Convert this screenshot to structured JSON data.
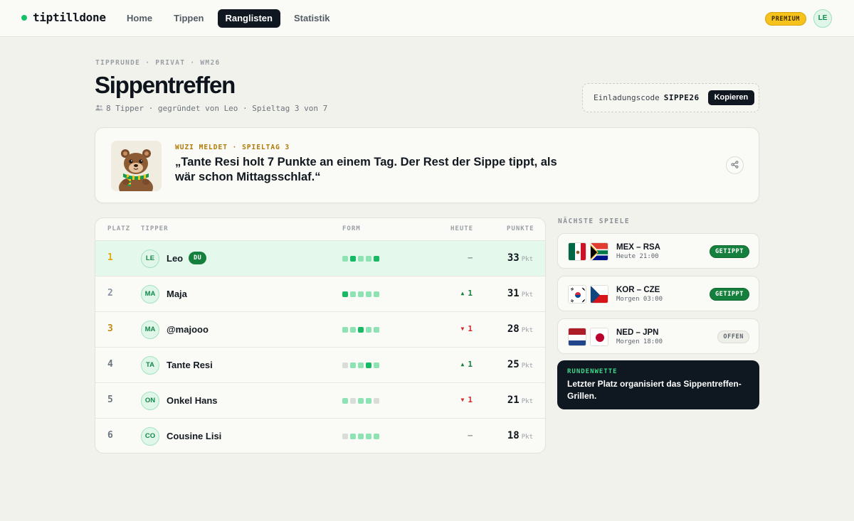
{
  "app": {
    "logo_text": "tiptilldone",
    "nav": [
      {
        "label": "Home",
        "active": false
      },
      {
        "label": "Tippen",
        "active": false
      },
      {
        "label": "Ranglisten",
        "active": true
      },
      {
        "label": "Statistik",
        "active": false
      }
    ],
    "premium_badge": "PREMIUM",
    "user_initials": "LE"
  },
  "header": {
    "eyebrow": "TIPPRUNDE · PRIVAT · WM26",
    "title": "Sippentreffen",
    "meta_icon": "people-icon",
    "meta": "8 Tipper · gegründet von Leo · Spieltag 3 von 7",
    "invite_label": "Einladungscode",
    "invite_code": "SIPPE26",
    "copy_label": "Kopieren"
  },
  "quote": {
    "kicker": "WUZI MELDET · SPIELTAG 3",
    "text": "„Tante Resi holt 7 Punkte an einem Tag. Der Rest der Sippe tippt, als wär schon Mittagsschlaf.“",
    "mascot": "otter-mascot",
    "share_icon": "share-icon"
  },
  "leaderboard": {
    "columns": {
      "rank": "PLATZ",
      "tipper": "TIPPER",
      "form": "FORM",
      "today": "HEUTE",
      "points": "PUNKTE"
    },
    "points_unit": "Pkt",
    "rows": [
      {
        "rank": "1",
        "initials": "LE",
        "name": "Leo",
        "badge": "DU",
        "form": [
          "d",
          "w",
          "d",
          "d",
          "w"
        ],
        "trend": "flat",
        "today": "–",
        "points": "33"
      },
      {
        "rank": "2",
        "initials": "MA",
        "name": "Maja",
        "form": [
          "w",
          "d",
          "d",
          "d",
          "d"
        ],
        "trend": "up",
        "today": "1",
        "points": "31"
      },
      {
        "rank": "3",
        "initials": "MA",
        "name": "@majooo",
        "form": [
          "d",
          "d",
          "w",
          "d",
          "d"
        ],
        "trend": "down",
        "today": "1",
        "points": "28"
      },
      {
        "rank": "4",
        "initials": "TA",
        "name": "Tante Resi",
        "form": [
          "l",
          "d",
          "d",
          "w",
          "d"
        ],
        "trend": "up",
        "today": "1",
        "points": "25"
      },
      {
        "rank": "5",
        "initials": "ON",
        "name": "Onkel Hans",
        "form": [
          "d",
          "l",
          "d",
          "d",
          "l"
        ],
        "trend": "down",
        "today": "1",
        "points": "21"
      },
      {
        "rank": "6",
        "initials": "CO",
        "name": "Cousine Lisi",
        "form": [
          "l",
          "d",
          "d",
          "d",
          "d"
        ],
        "trend": "flat",
        "today": "–",
        "points": "18"
      }
    ]
  },
  "upcoming": {
    "title": "NÄCHSTE SPIELE",
    "matches": [
      {
        "teams": "MEX – RSA",
        "time": "Heute 21:00",
        "status": "GETIPPT",
        "home_flag": "mexico-flag-icon",
        "away_flag": "south-africa-flag-icon"
      },
      {
        "teams": "KOR – CZE",
        "time": "Morgen 03:00",
        "status": "GETIPPT",
        "home_flag": "south-korea-flag-icon",
        "away_flag": "czechia-flag-icon"
      },
      {
        "teams": "NED – JPN",
        "time": "Morgen 18:00",
        "status": "OFFEN",
        "home_flag": "netherlands-flag-icon",
        "away_flag": "japan-flag-icon"
      }
    ]
  },
  "round_bet": {
    "kicker": "RUNDENWETTE",
    "text": "Letzter Platz organisiert das Sippentreffen-Grillen."
  },
  "colors": {
    "accent_green": "#16b964",
    "leader_row_bg": "#e4f8ec",
    "premium_yellow": "#f6c21c",
    "dark": "#101720"
  }
}
